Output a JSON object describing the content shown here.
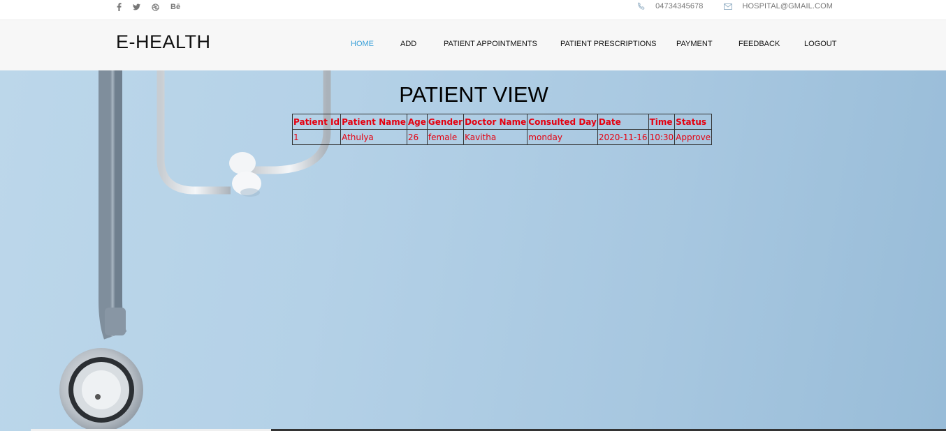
{
  "topbar": {
    "social": [
      "facebook-icon",
      "twitter-icon",
      "dribbble-icon",
      "behance-icon"
    ],
    "phone": "04734345678",
    "email": "HOSPITAL@GMAIL.COM"
  },
  "header": {
    "logo": "E-HEALTH",
    "nav": [
      {
        "label": "HOME",
        "active": true
      },
      {
        "label": "ADD"
      },
      {
        "label": "PATIENT APPOINTMENTS"
      },
      {
        "label": "PATIENT PRESCRIPTIONS"
      },
      {
        "label": "PAYMENT"
      },
      {
        "label": "FEEDBACK"
      },
      {
        "label": "LOGOUT"
      }
    ]
  },
  "main": {
    "title": "PATIENT VIEW",
    "table": {
      "columns": [
        "Patient Id",
        "Patient Name",
        "Age",
        "Gender",
        "Doctor Name",
        "Consulted Day",
        "Date",
        "Time",
        "Status"
      ],
      "rows": [
        [
          "1",
          "Athulya",
          "26",
          "female",
          "Kavitha",
          "monday",
          "2020-11-16",
          "10:30",
          "Approve"
        ]
      ]
    }
  },
  "colors": {
    "nav_active": "#3ba0d8",
    "table_text": "#e5000f",
    "hero_bg": "#b4d1e7"
  }
}
